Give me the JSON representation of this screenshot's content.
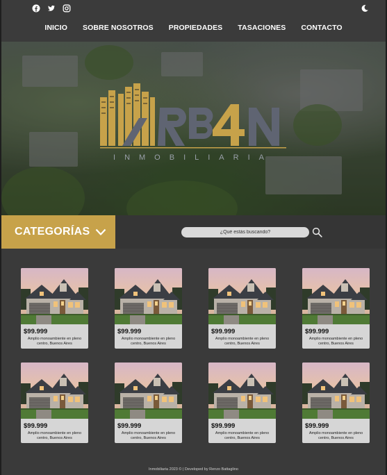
{
  "nav": {
    "items": [
      "INICIO",
      "SOBRE NOSOTROS",
      "PROPIEDADES",
      "TASACIONES",
      "CONTACTO"
    ]
  },
  "social": [
    "facebook-icon",
    "twitter-icon",
    "instagram-icon"
  ],
  "theme_toggle": "moon-icon",
  "brand": {
    "name": "URB4N",
    "tagline": "INMOBILIARIA",
    "gold": "#c7a24a",
    "slate": "#5f6472"
  },
  "categories": {
    "label": "CATEGORÍAS",
    "icon": "chevron-down-icon"
  },
  "search": {
    "placeholder": "¿Qué estás buscando?",
    "icon": "search-icon"
  },
  "listings": [
    {
      "price": "$99.999",
      "description": "Amplio monoambiente en pleno centro, Buenos Aires"
    },
    {
      "price": "$99.999",
      "description": "Amplio monoambiente en pleno centro, Buenos Aires"
    },
    {
      "price": "$99.999",
      "description": "Amplio monoambiente en pleno centro, Buenos Aires"
    },
    {
      "price": "$99.999",
      "description": "Amplio monoambiente en pleno centro, Buenos Aires"
    },
    {
      "price": "$99.999",
      "description": "Amplio monoambiente en pleno centro, Buenos Aires"
    },
    {
      "price": "$99.999",
      "description": "Amplio monoambiente en pleno centro, Buenos Aires"
    },
    {
      "price": "$99.999",
      "description": "Amplio monoambiente en pleno centro, Buenos Aires"
    },
    {
      "price": "$99.999",
      "description": "Amplio monoambiente en pleno centro, Buenos Aires"
    }
  ],
  "footer": {
    "text": "Inmobiliaria 2023 © | Developed by Renzo Battaglino"
  }
}
